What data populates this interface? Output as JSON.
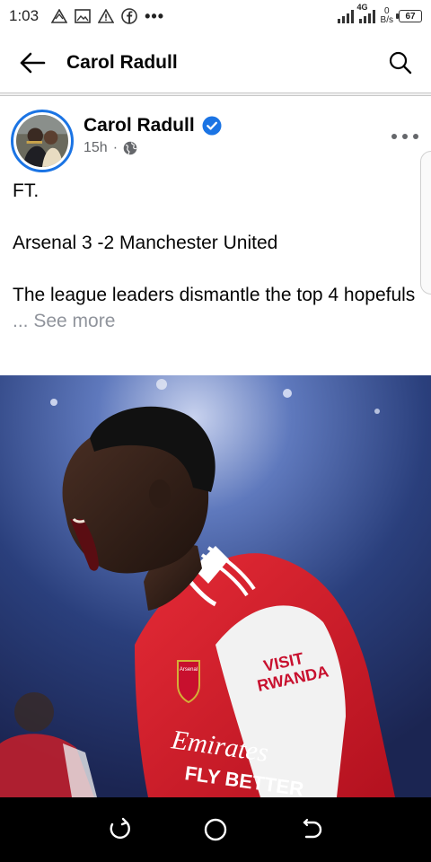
{
  "status_bar": {
    "time": "1:03",
    "icons": [
      "warning-triangle-icon",
      "image-icon",
      "alert-icon",
      "facebook-icon",
      "more-dots-icon"
    ],
    "more_dots": "•••",
    "network": "4G",
    "speed_value": "0",
    "speed_unit": "B/s",
    "battery": "67"
  },
  "header": {
    "title": "Carol Radull",
    "back_icon": "arrow-left-icon",
    "search_icon": "search-icon"
  },
  "post": {
    "author": "Carol Radull",
    "verified": true,
    "time": "15h",
    "separator": "·",
    "audience_icon": "globe-icon",
    "lines": [
      "FT.",
      "Arsenal 3 -2 Manchester United",
      "The league leaders dismantle the top 4 hopefuls"
    ],
    "see_more": "... See more",
    "photo": {
      "jersey_sponsor": "Emirates FLY BETTER",
      "sleeve_text": "VISIT RWANDA",
      "crest": "Arsenal"
    }
  },
  "nav_bar": {
    "buttons": [
      "recents-icon",
      "home-icon",
      "back-icon"
    ]
  },
  "colors": {
    "accent": "#1b74e4",
    "text": "#050505",
    "secondary_text": "#65676b",
    "see_more": "#90949c",
    "jersey_red": "#d7192b"
  }
}
